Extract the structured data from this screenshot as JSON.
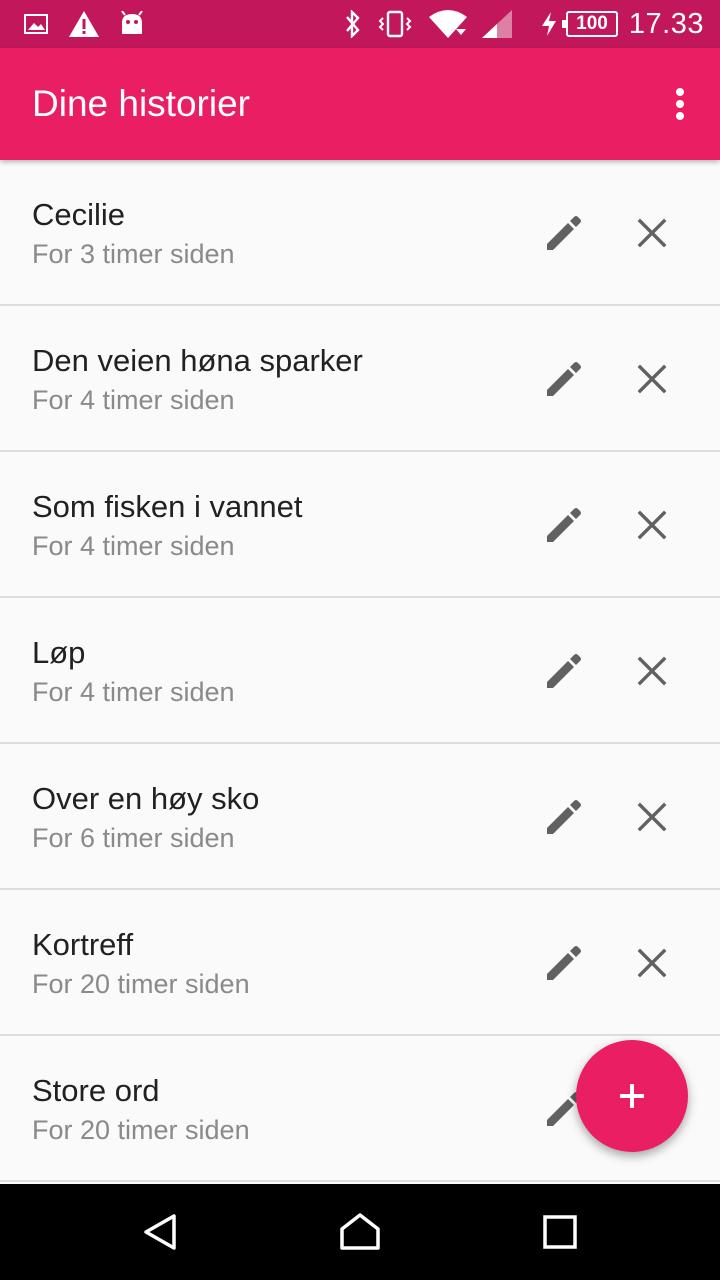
{
  "status_bar": {
    "time": "17.33",
    "battery_level": "100",
    "icons": [
      "image-notification-icon",
      "warning-icon",
      "android-icon",
      "bluetooth-icon",
      "vibrate-icon",
      "wifi-icon",
      "signal-icon",
      "charging-icon",
      "battery-icon"
    ],
    "color": "#c2185b"
  },
  "app_bar": {
    "title": "Dine historier",
    "menu_icon": "more-vert-icon",
    "color": "#e91e63"
  },
  "stories": [
    {
      "title": "Cecilie",
      "time": "For 3 timer siden"
    },
    {
      "title": "Den veien høna sparker",
      "time": "For 4 timer siden"
    },
    {
      "title": "Som fisken i vannet",
      "time": "For 4 timer siden"
    },
    {
      "title": "Løp",
      "time": "For 4 timer siden"
    },
    {
      "title": "Over en høy sko",
      "time": "For 6 timer siden"
    },
    {
      "title": "Kortreff",
      "time": "For 20 timer siden"
    },
    {
      "title": "Store ord",
      "time": "For 20 timer siden"
    }
  ],
  "item_actions": {
    "edit_icon": "pencil-icon",
    "delete_icon": "close-icon"
  },
  "fab": {
    "label": "+",
    "icon": "add-icon",
    "color": "#e91e63"
  },
  "nav_bar": {
    "buttons": [
      "back-icon",
      "home-icon",
      "recents-icon"
    ]
  }
}
